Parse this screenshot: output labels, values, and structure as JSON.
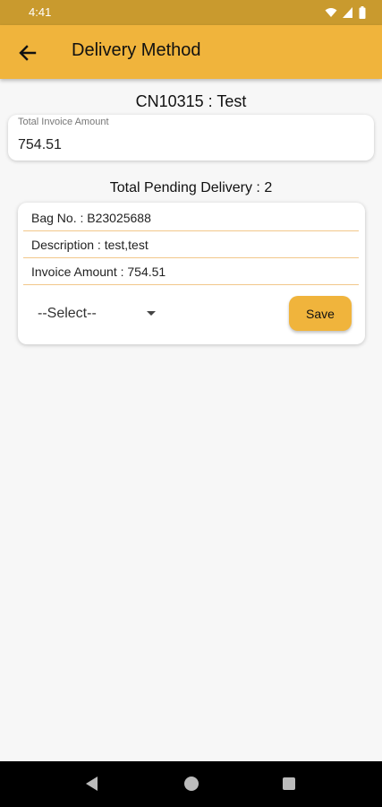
{
  "status_bar": {
    "time": "4:41",
    "icons": [
      "wifi-icon",
      "signal-icon",
      "battery-icon"
    ]
  },
  "app_bar": {
    "title": "Delivery Method",
    "back_icon": "back-arrow-icon"
  },
  "customer": {
    "title": "CN10315 : Test"
  },
  "invoice": {
    "label": "Total Invoice Amount",
    "value": "754.51"
  },
  "pending": {
    "title": "Total Pending Delivery : 2"
  },
  "delivery_card": {
    "bag_no": "Bag No. : B23025688",
    "description": "Description :  test,test",
    "invoice_amount": "Invoice Amount : 754.51",
    "select_value": "--Select--",
    "save_label": "Save"
  },
  "colors": {
    "accent": "#f0b43c",
    "status_bar": "#c99a2e",
    "divider": "#f2c78a"
  },
  "nav_bar": {
    "icons": [
      "back-triangle-icon",
      "home-circle-icon",
      "recents-square-icon"
    ]
  }
}
